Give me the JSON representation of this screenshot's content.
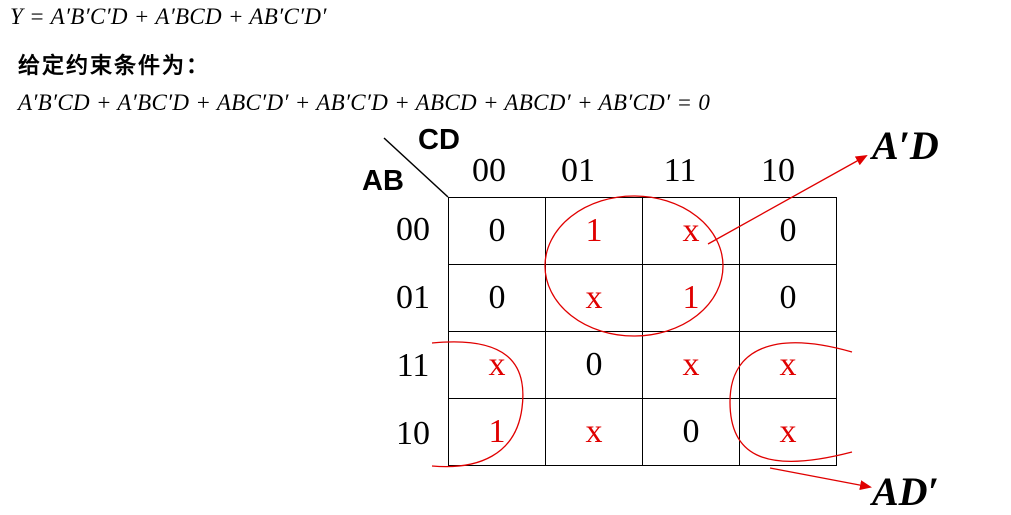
{
  "equation": "Y = A′B′C′D + A′BCD + AB′C′D′",
  "constraint_label": "给定约束条件为：",
  "constraint_equation": "A′B′CD + A′BC′D + ABC′D′ + AB′C′D + ABCD + ABCD′ + AB′CD′ = 0",
  "kmap": {
    "col_var": "CD",
    "row_var": "AB",
    "col_headers": [
      "00",
      "01",
      "11",
      "10"
    ],
    "row_headers": [
      "00",
      "01",
      "11",
      "10"
    ],
    "cells": [
      [
        "0",
        "1",
        "x",
        "0"
      ],
      [
        "0",
        "x",
        "1",
        "0"
      ],
      [
        "x",
        "0",
        "x",
        "x"
      ],
      [
        "1",
        "x",
        "0",
        "x"
      ]
    ]
  },
  "groups": [
    {
      "term": "A′D"
    },
    {
      "term": "AD′"
    }
  ],
  "colors": {
    "ink": "#000000",
    "mark": "#e00000"
  }
}
